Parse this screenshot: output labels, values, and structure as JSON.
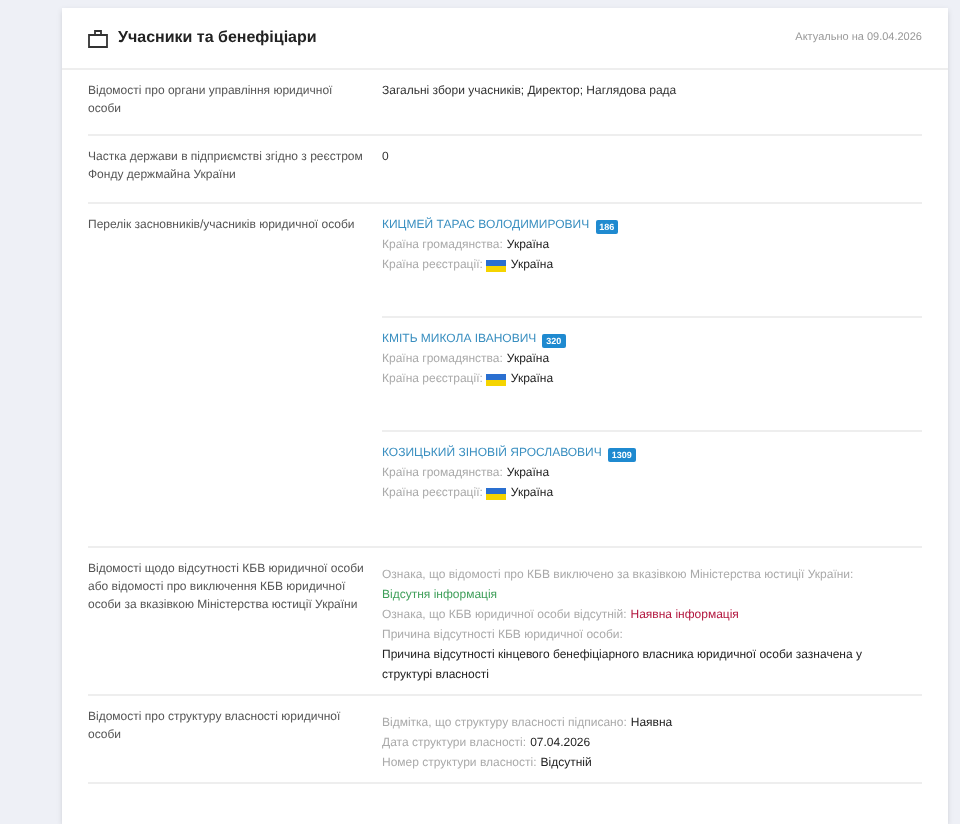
{
  "section": {
    "title": "Учасники та бенефіціари",
    "updated": "Актуально на 09.04.2026"
  },
  "rows": [
    {
      "kind": "text",
      "label": "Відомості про органи управління юридичної особи",
      "value": "Загальні збори учасників; Директор; Наглядова рада"
    },
    {
      "kind": "text",
      "label": "Частка держави в підприємстві згідно з реєстром Фонду держмайна України",
      "value": "0"
    },
    {
      "kind": "founders",
      "label": "Перелік засновників/учасників юридичної особи",
      "founders": [
        {
          "name": "КИЦМЕЙ ТАРАС ВОЛОДИМИРОВИЧ",
          "badge": "186",
          "citizenship_label": "Країна громадянства:",
          "citizenship": "Україна",
          "registration_label": "Країна реєстрації:",
          "registration": "Україна"
        },
        {
          "name": "КМІТЬ МИКОЛА ІВАНОВИЧ",
          "badge": "320",
          "citizenship_label": "Країна громадянства:",
          "citizenship": "Україна",
          "registration_label": "Країна реєстрації:",
          "registration": "Україна"
        },
        {
          "name": "КОЗИЦЬКИЙ ЗІНОВІЙ ЯРОСЛАВОВИЧ",
          "badge": "1309",
          "citizenship_label": "Країна громадянства:",
          "citizenship": "Україна",
          "registration_label": "Країна реєстрації:",
          "registration": "Україна"
        }
      ]
    },
    {
      "kind": "facts",
      "label": "Відомості щодо відсутності КБВ юридичної особи або відомості про виключення КБВ юридичної особи за вказівкою Міністерства юстиції України",
      "facts": [
        {
          "label": "Ознака, що відомості про КБВ виключено за вказівкою Міністерства юстиції України:",
          "value": "Відсутня інформація",
          "color": "#3f9f5a"
        },
        {
          "label": "Ознака, що КБВ юридичної особи відсутній:",
          "value": "Наявна інформація",
          "color": "#b3173f"
        },
        {
          "label": "Причина відсутності КБВ юридичної особи:",
          "value": "Причина відсутності кінцевого бенефіціарного власника юридичної особи зазначена у структурі власності",
          "color": "#222222"
        }
      ]
    },
    {
      "kind": "facts",
      "label": "Відомості про структуру власності юридичної особи",
      "facts": [
        {
          "label": "Відмітка, що структуру власності підписано:",
          "value": "Наявна",
          "color": "#222222"
        },
        {
          "label": "Дата структури власності:",
          "value": "07.04.2026",
          "color": "#222222"
        },
        {
          "label": "Номер структури власності:",
          "value": "Відсутній",
          "color": "#222222"
        }
      ]
    }
  ]
}
